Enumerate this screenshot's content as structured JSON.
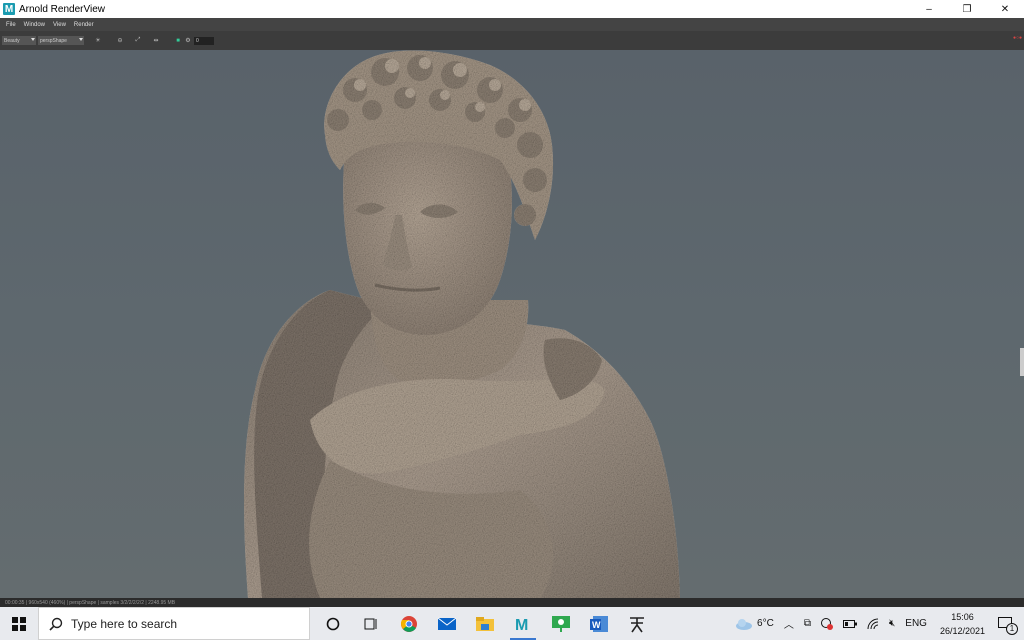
{
  "window": {
    "title": "Arnold RenderView",
    "icon_letter": "M",
    "controls": {
      "minimize": "–",
      "restore": "❐",
      "close": "✕"
    }
  },
  "menu": [
    "File",
    "Window",
    "View",
    "Render"
  ],
  "toolbar": {
    "aov": "Beauty",
    "camera": "perspShape",
    "exposure": "0",
    "icons": [
      "sun-icon",
      "refresh-icon",
      "crop-icon",
      "region-icon",
      "stop-icon",
      "settings-icon"
    ]
  },
  "viewport": {
    "image": "render of a sandstone statue bust (man with curly hair and draped cloak)",
    "background_color": "#5e686e"
  },
  "statusbar": {
    "text": "00:00:35 | 960x540 (460%) | perspShape | samples 3/2/2/2/2/2 | 2248.95 MB"
  },
  "taskbar": {
    "search_placeholder": "Type here to search",
    "apps": [
      "task-view",
      "chrome",
      "mail",
      "file-explorer",
      "maya",
      "screen-sketch",
      "word",
      "zbrush"
    ],
    "active_app": "maya",
    "weather": "6°C",
    "language": "ENG",
    "time": "15:06",
    "date": "26/12/2021",
    "notifications": "1"
  }
}
